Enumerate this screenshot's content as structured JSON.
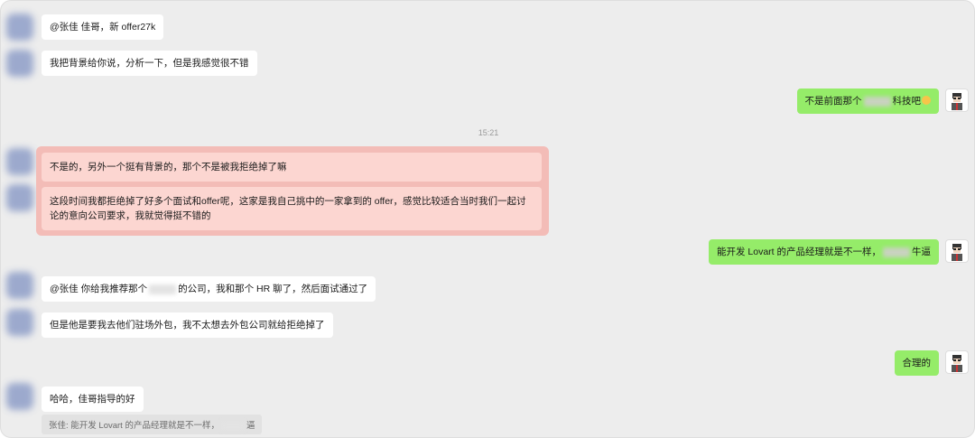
{
  "messages": {
    "m1": "@张佳 佳哥，新 offer27k",
    "m2": "我把背景给你说，分析一下，但是我感觉很不错",
    "m3_pre": "不是前面那个",
    "m3_post": "科技吧",
    "time": "15:21",
    "m4": "不是的，另外一个挺有背景的，那个不是被我拒绝掉了嘛",
    "m5": "这段时间我都拒绝掉了好多个面试和offer呢，这家是我自己挑中的一家拿到的 offer，感觉比较适合当时我们一起讨论的意向公司要求，我就觉得挺不错的",
    "m6_pre": "能开发 Lovart 的产品经理就是不一样，",
    "m6_post": "牛逼",
    "m7_pre": "@张佳 你给我推荐那个",
    "m7_post": "的公司，我和那个 HR 聊了，然后面试通过了",
    "m8": "但是他是要我去他们驻场外包，我不太想去外包公司就给拒绝掉了",
    "m9": "合理的",
    "m10": "哈哈，佳哥指导的好",
    "quote_pre": "张佳: 能开发 Lovart 的产品经理就是不一样，",
    "quote_post": "逼"
  },
  "colors": {
    "window_bg": "#ededed",
    "bubble_out": "#95ec69",
    "bubble_in": "#ffffff",
    "highlight": "#f3bcb7"
  }
}
